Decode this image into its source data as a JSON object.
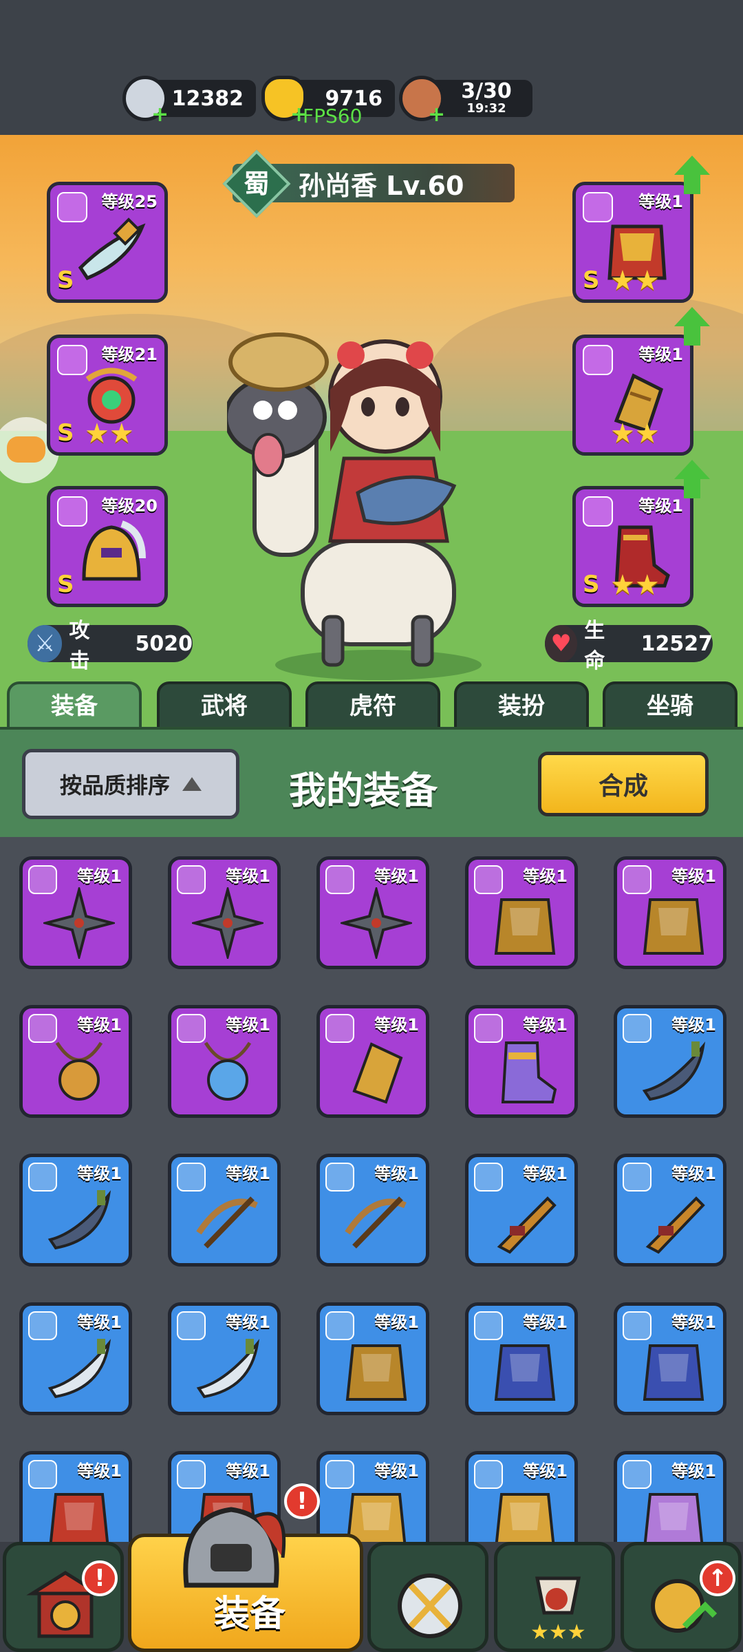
{
  "resources": {
    "silver": "12382",
    "gold": "9716",
    "stamina": "3/30",
    "stamina_timer": "19:32",
    "fps": "FPS60"
  },
  "hero": {
    "faction": "蜀",
    "name": "孙尚香 Lv.60"
  },
  "slots_left": [
    {
      "level": "等级25",
      "grade": "S",
      "stars": ""
    },
    {
      "level": "等级21",
      "grade": "S",
      "stars": "★★"
    },
    {
      "level": "等级20",
      "grade": "S",
      "stars": ""
    }
  ],
  "slots_right": [
    {
      "level": "等级1",
      "grade": "S",
      "stars": "★★"
    },
    {
      "level": "等级1",
      "grade": "",
      "stars": "★★"
    },
    {
      "level": "等级1",
      "grade": "S",
      "stars": "★★"
    }
  ],
  "stats": {
    "attack_label": "攻击",
    "attack_value": "5020",
    "hp_label": "生命",
    "hp_value": "12527"
  },
  "tabs": [
    "装备",
    "武将",
    "虎符",
    "装扮",
    "坐骑"
  ],
  "panel": {
    "sort_label": "按品质排序",
    "title": "我的装备",
    "merge_label": "合成"
  },
  "grid_items": [
    {
      "level": "等级1",
      "rarity": "purple",
      "icon": "shuriken-icon"
    },
    {
      "level": "等级1",
      "rarity": "purple",
      "icon": "shuriken-icon"
    },
    {
      "level": "等级1",
      "rarity": "purple",
      "icon": "shuriken-icon"
    },
    {
      "level": "等级1",
      "rarity": "purple",
      "icon": "golden-helmet-icon"
    },
    {
      "level": "等级1",
      "rarity": "purple",
      "icon": "golden-helmet-icon"
    },
    {
      "level": "等级1",
      "rarity": "purple",
      "icon": "amulet-icon"
    },
    {
      "level": "等级1",
      "rarity": "purple",
      "icon": "blue-amulet-icon"
    },
    {
      "level": "等级1",
      "rarity": "purple",
      "icon": "bracer-icon"
    },
    {
      "level": "等级1",
      "rarity": "purple",
      "icon": "boots-icon"
    },
    {
      "level": "等级1",
      "rarity": "blue",
      "icon": "blade-icon"
    },
    {
      "level": "等级1",
      "rarity": "blue",
      "icon": "blade-icon"
    },
    {
      "level": "等级1",
      "rarity": "blue",
      "icon": "crossbow-icon"
    },
    {
      "level": "等级1",
      "rarity": "blue",
      "icon": "crossbow-icon"
    },
    {
      "level": "等级1",
      "rarity": "blue",
      "icon": "musket-icon"
    },
    {
      "level": "等级1",
      "rarity": "blue",
      "icon": "musket-icon"
    },
    {
      "level": "等级1",
      "rarity": "blue",
      "icon": "glaive-icon"
    },
    {
      "level": "等级1",
      "rarity": "blue",
      "icon": "glaive-icon"
    },
    {
      "level": "等级1",
      "rarity": "blue",
      "icon": "bronze-armor-icon"
    },
    {
      "level": "等级1",
      "rarity": "blue",
      "icon": "blue-robe-icon"
    },
    {
      "level": "等级1",
      "rarity": "blue",
      "icon": "blue-robe-icon"
    },
    {
      "level": "等级1",
      "rarity": "blue",
      "icon": "red-robe-icon"
    },
    {
      "level": "等级1",
      "rarity": "blue",
      "icon": "red-robe-icon"
    },
    {
      "level": "等级1",
      "rarity": "blue",
      "icon": "gold-armor-icon"
    },
    {
      "level": "等级1",
      "rarity": "blue",
      "icon": "gold-armor-icon"
    },
    {
      "level": "等级1",
      "rarity": "blue",
      "icon": "purple-armor-icon"
    }
  ],
  "bottom_nav": {
    "active_label": "装备"
  }
}
